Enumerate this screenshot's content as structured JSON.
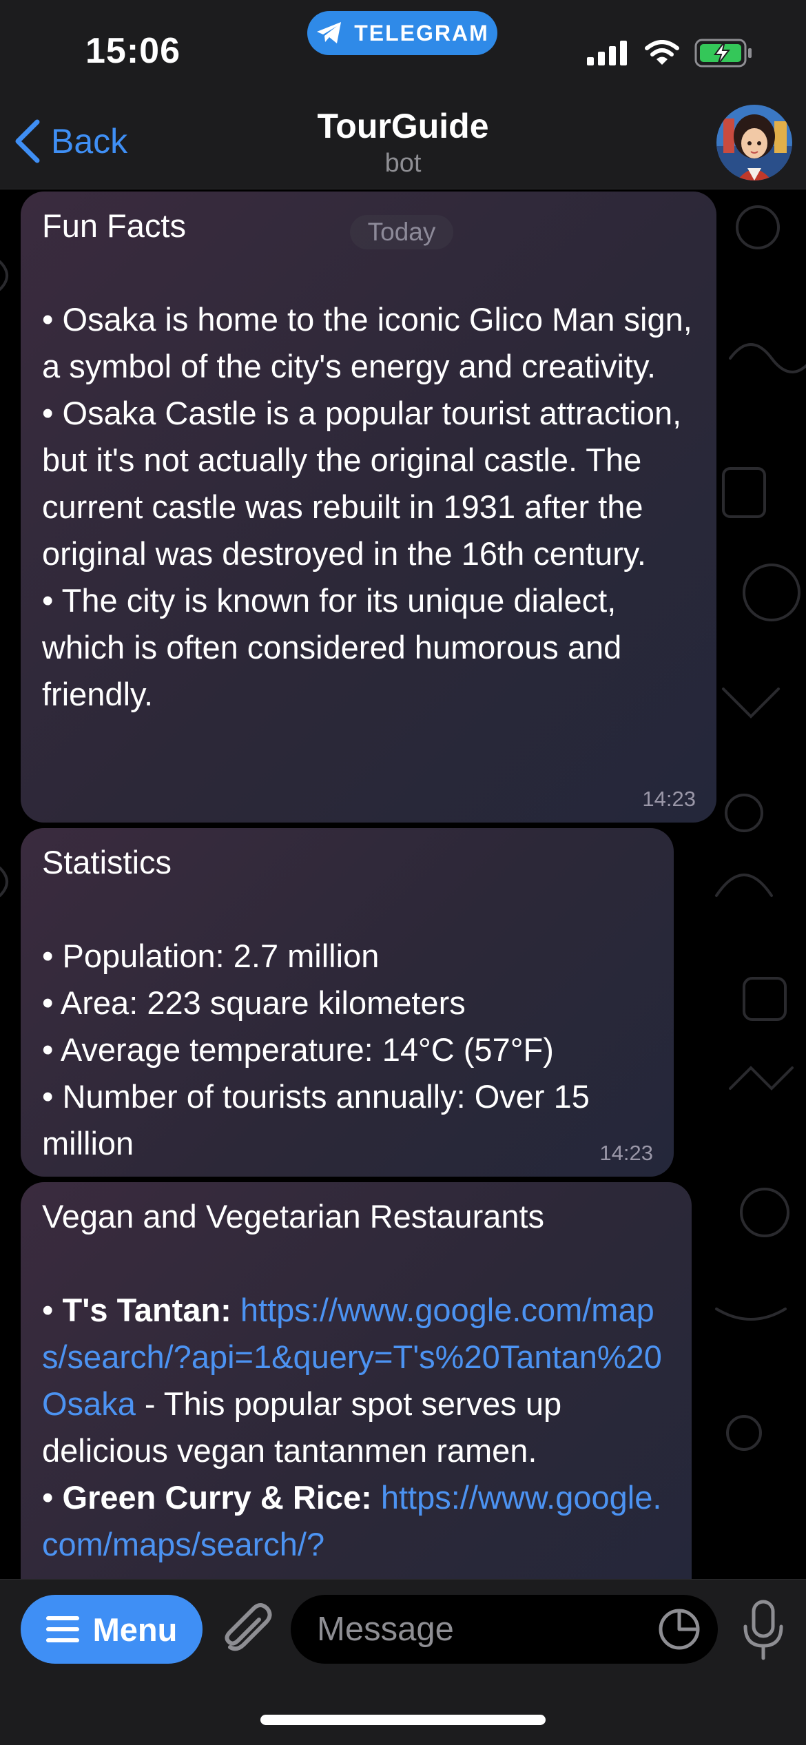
{
  "status_bar": {
    "time": "15:06",
    "app_pill": "TELEGRAM",
    "icons": [
      "signal-icon",
      "wifi-icon",
      "battery-charging-icon"
    ],
    "battery_color": "#34c759"
  },
  "header": {
    "back_label": "Back",
    "title": "TourGuide",
    "subtitle": "bot"
  },
  "date_chip": "Today",
  "messages": [
    {
      "heading": "Fun Facts",
      "lines": [
        "• Osaka is home to the iconic Glico Man sign, a symbol of the city's energy and creativity.",
        "• Osaka Castle is a popular tourist attraction, but it's not actually the original castle. The current castle was rebuilt in 1931 after the original was destroyed in the 16th century.",
        "• The city is known for its unique dialect, which is often considered humorous and friendly."
      ],
      "time": "14:23"
    },
    {
      "heading": "Statistics",
      "lines": [
        "• Population: 2.7 million",
        "• Area: 223 square kilometers",
        "• Average temperature: 14°C (57°F)",
        "• Number of tourists annually: Over 15 million"
      ],
      "time": "14:23"
    },
    {
      "heading": "Vegan and Vegetarian Restaurants",
      "items": [
        {
          "name": "T's Tantan:",
          "url": "https://www.google.com/maps/search/?api=1&query=T's%20Tantan%20Osaka",
          "description": "- This popular spot serves up delicious vegan tantanmen ramen."
        },
        {
          "name": "Green Curry & Rice:",
          "url": "https://www.google.com/maps/search/?",
          "description": ""
        }
      ]
    }
  ],
  "composer": {
    "menu_label": "Menu",
    "message_placeholder": "Message"
  },
  "colors": {
    "accent": "#3f8ff5",
    "link": "#4c93f2",
    "telegram_pill": "#2f8ae8"
  }
}
